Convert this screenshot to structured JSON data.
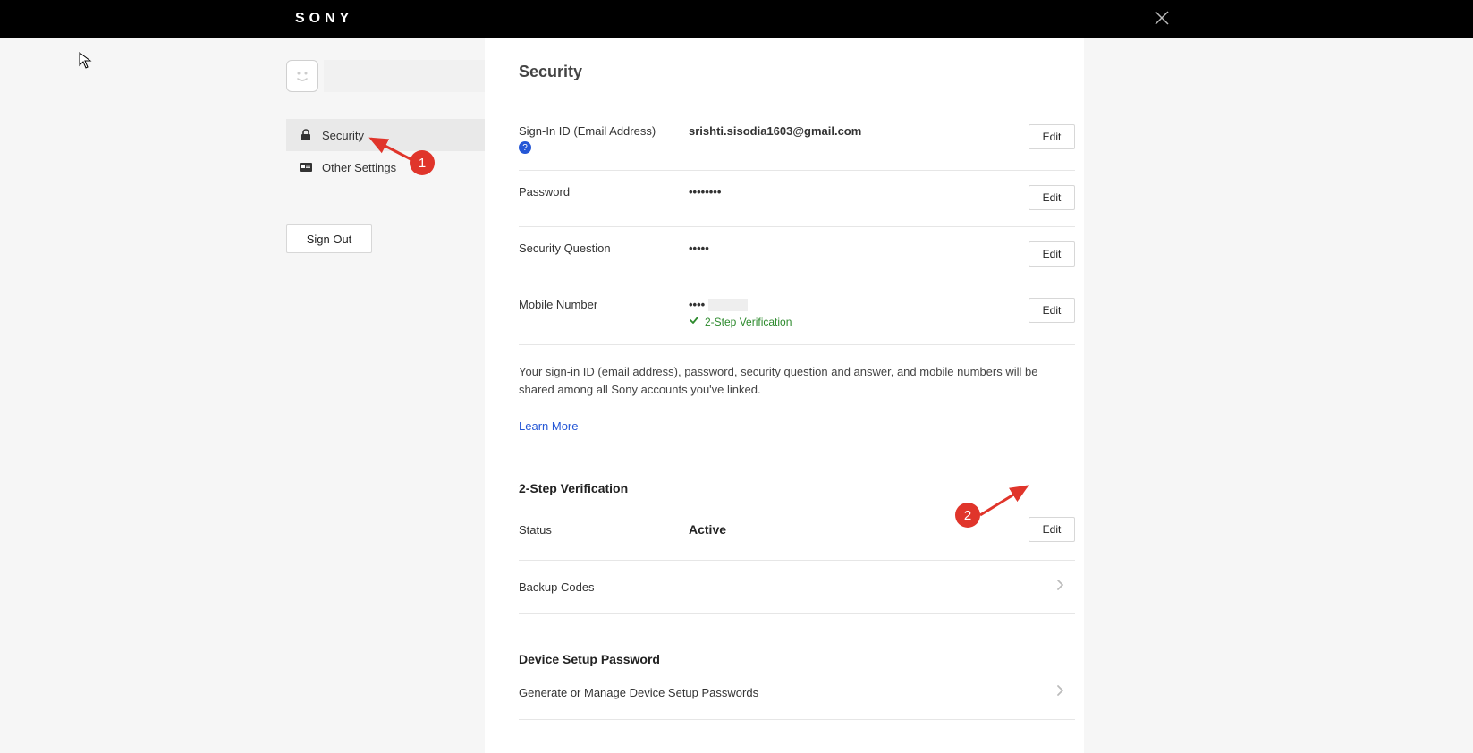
{
  "brand": "SONY",
  "sidebar": {
    "items": [
      {
        "label": "Security"
      },
      {
        "label": "Other Settings"
      }
    ],
    "signout": "Sign Out"
  },
  "main": {
    "title": "Security",
    "fields": {
      "signin_id": {
        "label": "Sign-In ID (Email Address)",
        "value": "srishti.sisodia1603@gmail.com",
        "edit": "Edit"
      },
      "password": {
        "label": "Password",
        "value": "••••••••",
        "edit": "Edit"
      },
      "security_question": {
        "label": "Security Question",
        "value": "•••••",
        "edit": "Edit"
      },
      "mobile": {
        "label": "Mobile Number",
        "value": "••••",
        "twostep": "2-Step Verification",
        "edit": "Edit"
      }
    },
    "note": "Your sign-in ID (email address), password, security question and answer, and mobile numbers will be shared among all Sony accounts you've linked.",
    "learn_more": "Learn More",
    "twostep_section": {
      "title": "2-Step Verification",
      "status_label": "Status",
      "status_value": "Active",
      "edit": "Edit",
      "backup_codes": "Backup Codes"
    },
    "device_section": {
      "title": "Device Setup Password",
      "manage": "Generate or Manage Device Setup Passwords"
    }
  },
  "annotations": {
    "callout1": "1",
    "callout2": "2"
  }
}
